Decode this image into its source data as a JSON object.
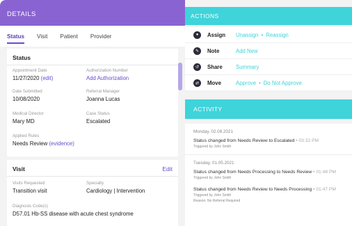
{
  "details": {
    "title": "DETAILS",
    "tabs": [
      "Status",
      "Visit",
      "Patient",
      "Provider"
    ],
    "status_card": {
      "title": "Status",
      "fields": {
        "appointment_date_label": "Appointment Date",
        "appointment_date_value": "11/27/2020",
        "appointment_date_edit": "(edit)",
        "authorization_label": "Authorization Number",
        "authorization_link": "Add Authorization",
        "date_submitted_label": "Date Submitted",
        "date_submitted_value": "10/08/2020",
        "referral_manager_label": "Referral Manager",
        "referral_manager_value": "Joanna Lucas",
        "medical_director_label": "Medical Director",
        "medical_director_value": "Mary MD",
        "case_status_label": "Case Status",
        "case_status_value": "Escalated",
        "applied_rules_label": "Applied Rules",
        "applied_rules_value": "Needs Review",
        "applied_rules_link": "(evidence)"
      }
    },
    "visit_card": {
      "title": "Visit",
      "edit_label": "Edit",
      "visits_requested_label": "Visits Requested",
      "visits_requested_value": "Transition visit",
      "specialty_label": "Specialty",
      "specialty_value": "Cardiology | Intervention",
      "diagnosis_label": "Diagnosis Code(s)",
      "diagnosis_value": "D57.01 Hb-SS disease with acute chest syndrome"
    }
  },
  "actions": {
    "title": "ACTIONS",
    "rows": [
      {
        "name": "Assign",
        "links": [
          "Unassign",
          "Reassign"
        ]
      },
      {
        "name": "Note",
        "links": [
          "Add New"
        ]
      },
      {
        "name": "Share",
        "links": [
          "Summary"
        ]
      },
      {
        "name": "Move",
        "links": [
          "Approve",
          "Do Not Approve"
        ]
      }
    ]
  },
  "activity": {
    "title": "ACTIVITY",
    "days": [
      {
        "date": "Monday, 02.08.2021",
        "entries": [
          {
            "text": "Status changed from Needs Review to Escalated",
            "time": "03:32 PM",
            "by": "Triggered by John Smith",
            "reason": ""
          }
        ]
      },
      {
        "date": "Tuesday, 01.05.2021",
        "entries": [
          {
            "text": "Status changed from Needs Processing to Needs Review",
            "time": "01:48 PM",
            "by": "Triggered by John Smith",
            "reason": ""
          },
          {
            "text": "Status changed from Needs Review to Needs Processing",
            "time": "01:47 PM",
            "by": "Triggered by John Smith",
            "reason": "Reason: No Referral Required"
          }
        ]
      }
    ]
  },
  "colors": {
    "purple": "#8a63d2",
    "teal": "#3fd3da",
    "link": "#6a4bd0"
  }
}
